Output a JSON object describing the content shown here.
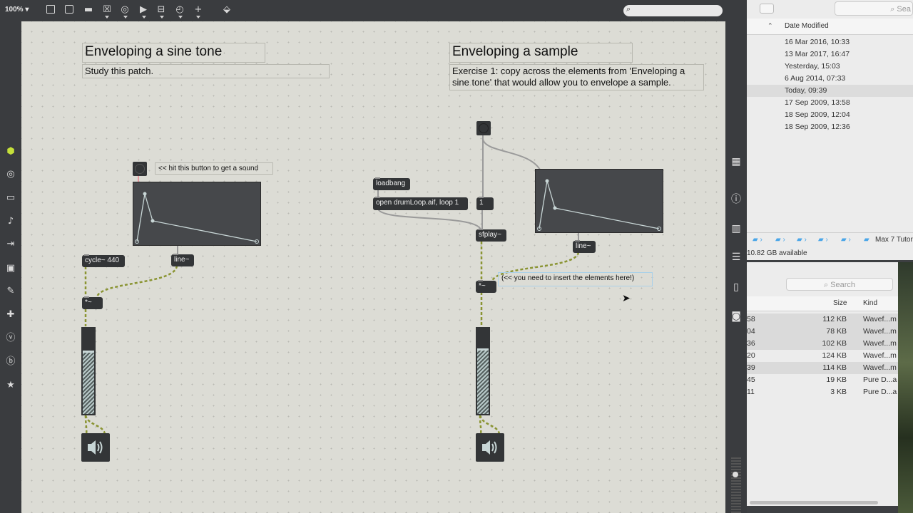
{
  "toolbar": {
    "zoom": "100%",
    "icons": [
      "new-object-icon",
      "message-icon",
      "comment-icon",
      "toggle-icon",
      "button-icon",
      "number-icon",
      "slider-icon",
      "dial-icon",
      "add-icon",
      "paint-icon"
    ]
  },
  "patch": {
    "left": {
      "title": "Enveloping a sine tone",
      "subtitle": "Study this patch.",
      "hint": "<< hit this button to get a sound",
      "cycle": "cycle~ 440",
      "line": "line~",
      "mult": "*~"
    },
    "right": {
      "title": "Enveloping a sample",
      "exercise": "Exercise 1: copy across the elements from 'Enveloping a sine tone' that would allow you to envelope a sample.",
      "loadbang": "loadbang",
      "open_msg": "open drumLoop.aif, loop 1",
      "one_msg": "1",
      "sfplay": "sfplay~",
      "line": "line~",
      "mult": "*~",
      "insert_hint": "(<< you need to insert the elements here!)"
    },
    "gain_left_level": 0.72,
    "gain_right_level": 0.74
  },
  "finder": {
    "date_header": "Date Modified",
    "dates": [
      "16 Mar 2016, 10:33",
      "13 Mar 2017, 16:47",
      "Yesterday, 15:03",
      "6 Aug 2014, 07:33",
      "Today, 09:39",
      "17 Sep 2009, 13:58",
      "18 Sep 2009, 12:04",
      "18 Sep 2009, 12:36"
    ],
    "search_top": "Sea",
    "path_last": "Max 7 Tutor",
    "available": "10.82 GB available",
    "search": "Search",
    "size_header": "Size",
    "kind_header": "Kind",
    "rows": [
      {
        "name": "58",
        "size": "112 KB",
        "kind": "Wavef...m"
      },
      {
        "name": "04",
        "size": "78 KB",
        "kind": "Wavef...m"
      },
      {
        "name": "36",
        "size": "102 KB",
        "kind": "Wavef...m"
      },
      {
        "name": "20",
        "size": "124 KB",
        "kind": "Wavef...m"
      },
      {
        "name": "39",
        "size": "114 KB",
        "kind": "Wavef...m"
      },
      {
        "name": "45",
        "size": "19 KB",
        "kind": "Pure D...a"
      },
      {
        "name": "11",
        "size": "3 KB",
        "kind": "Pure D...a"
      }
    ]
  },
  "colors": {
    "canvas": "#dcdcd5",
    "object": "#333537",
    "cord": "#9ea833",
    "accent": "#a9d0e8"
  }
}
